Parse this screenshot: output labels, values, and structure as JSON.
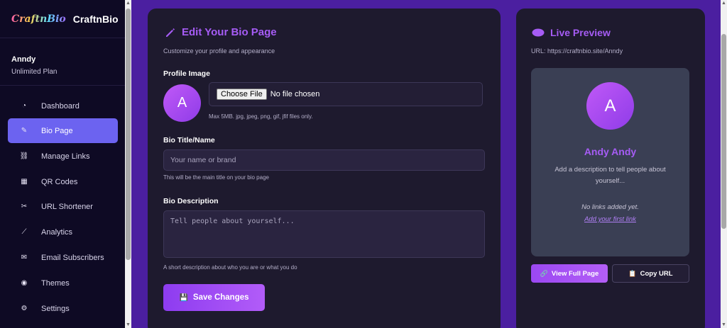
{
  "brand": {
    "logo": "CraftnBio",
    "name": "CraftnBio"
  },
  "user": {
    "name": "Anndy",
    "plan": "Unlimited Plan"
  },
  "sidebar": {
    "items": [
      {
        "label": "Dashboard",
        "icon": "dashboard-icon",
        "glyph": "◔"
      },
      {
        "label": "Bio Page",
        "icon": "edit-icon",
        "glyph": "✎",
        "active": true
      },
      {
        "label": "Manage Links",
        "icon": "link-icon",
        "glyph": "⛓"
      },
      {
        "label": "QR Codes",
        "icon": "qr-code-icon",
        "glyph": "▦"
      },
      {
        "label": "URL Shortener",
        "icon": "scissors-icon",
        "glyph": "✂"
      },
      {
        "label": "Analytics",
        "icon": "chart-icon",
        "glyph": "⟋"
      },
      {
        "label": "Email Subscribers",
        "icon": "envelope-icon",
        "glyph": "✉"
      },
      {
        "label": "Themes",
        "icon": "palette-icon",
        "glyph": "◉"
      },
      {
        "label": "Settings",
        "icon": "gear-icon",
        "glyph": "⚙"
      }
    ]
  },
  "editor": {
    "title": "Edit Your Bio Page",
    "subtitle": "Customize your profile and appearance",
    "profile_image_label": "Profile Image",
    "avatar_initial": "A",
    "file_button": "Choose File",
    "file_status": "No file chosen",
    "file_hint": "Max 5MB. jpg, jpeg, png, gif, jfif files only.",
    "bio_title_label": "Bio Title/Name",
    "bio_title_placeholder": "Your name or brand",
    "bio_title_hint": "This will be the main title on your bio page",
    "bio_desc_label": "Bio Description",
    "bio_desc_placeholder": "Tell people about yourself...",
    "bio_desc_hint": "A short description about who you are or what you do",
    "save_label": "Save Changes"
  },
  "preview": {
    "title": "Live Preview",
    "url": "URL: https://craftnbio.site/Anndy",
    "avatar_initial": "A",
    "name": "Andy Andy",
    "description": "Add a description to tell people about yourself...",
    "no_links": "No links added yet.",
    "add_link": "Add your first link",
    "view_full": "View Full Page",
    "copy_url": "Copy URL"
  },
  "colors": {
    "accent": "#a65cf5",
    "sidebar_bg": "#0e0a24",
    "page_bg": "#4b1fa0",
    "active_nav": "#6c63f0"
  }
}
